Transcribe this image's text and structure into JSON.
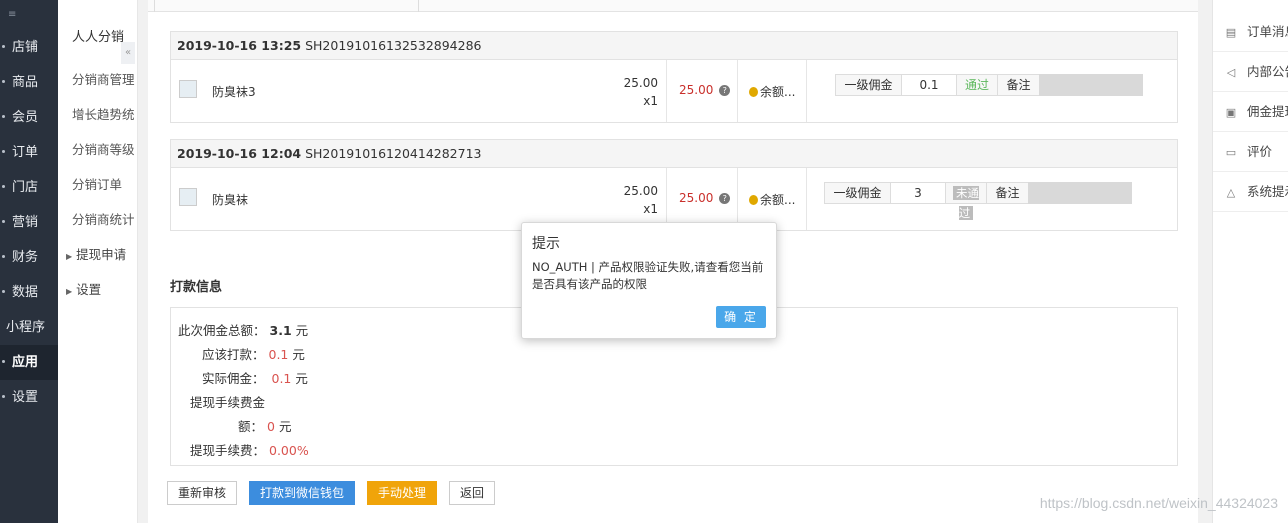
{
  "nav": {
    "items": [
      {
        "label": "店铺"
      },
      {
        "label": "商品"
      },
      {
        "label": "会员"
      },
      {
        "label": "订单"
      },
      {
        "label": "门店"
      },
      {
        "label": "营销"
      },
      {
        "label": "财务"
      },
      {
        "label": "数据"
      },
      {
        "label": "小程序"
      },
      {
        "label": "应用"
      },
      {
        "label": "设置"
      }
    ]
  },
  "subnav": {
    "title": "人人分销",
    "links": [
      "分销商管理",
      "增长趋势统",
      "分销商等级",
      "分销订单",
      "分销商统计"
    ],
    "groups": [
      "提现申请",
      "设置"
    ]
  },
  "orders": [
    {
      "date": "2019-10-16 13:25",
      "order_no": "SH20191016132532894286",
      "product": "防臭袜3",
      "unit_price": "25.00",
      "qty": "x1",
      "total": "25.00",
      "pay": "余额...",
      "commission_label": "一级佣金",
      "commission_value": "0.1",
      "status": "通过",
      "note_label": "备注"
    },
    {
      "date": "2019-10-16 12:04",
      "order_no": "SH20191016120414282713",
      "product": "防臭袜",
      "unit_price": "25.00",
      "qty": "x1",
      "total": "25.00",
      "pay": "余额...",
      "commission_label": "一级佣金",
      "commission_value": "3",
      "status": "未通过",
      "note_label": "备注"
    }
  ],
  "payment": {
    "title": "打款信息",
    "total_label": "此次佣金总额：",
    "total_value": "3.1",
    "due_label": "应该打款：",
    "due_value": "0.1",
    "actual_label": "实际佣金：",
    "actual_value": "0.1",
    "fee_amount_label_1": "提现手续费金",
    "fee_amount_label_2": "额：",
    "fee_amount_value": "0",
    "fee_rate_label": "提现手续费：",
    "fee_rate_value": "0.00%",
    "unit": "元"
  },
  "actions": {
    "recheck": "重新审核",
    "pay_wechat": "打款到微信钱包",
    "manual": "手动处理",
    "back": "返回"
  },
  "right_panel": {
    "items": [
      {
        "label": "订单消息",
        "icon": "document-icon"
      },
      {
        "label": "内部公告",
        "icon": "speaker-icon"
      },
      {
        "label": "佣金提现",
        "icon": "wallet-icon"
      },
      {
        "label": "评价",
        "icon": "comment-icon"
      },
      {
        "label": "系统提示",
        "icon": "bell-icon"
      }
    ]
  },
  "modal": {
    "title": "提示",
    "message": "NO_AUTH | 产品权限验证失败,请查看您当前是否具有该产品的权限",
    "ok": "确 定"
  },
  "watermark": "https://blog.csdn.net/weixin_44324023",
  "colors": {
    "nav_bg": "#29313d",
    "primary": "#3c8dde",
    "warning": "#f0a40a",
    "danger": "#c9302c",
    "success": "#5cb85c",
    "modal_ok": "#4aa7ea"
  }
}
